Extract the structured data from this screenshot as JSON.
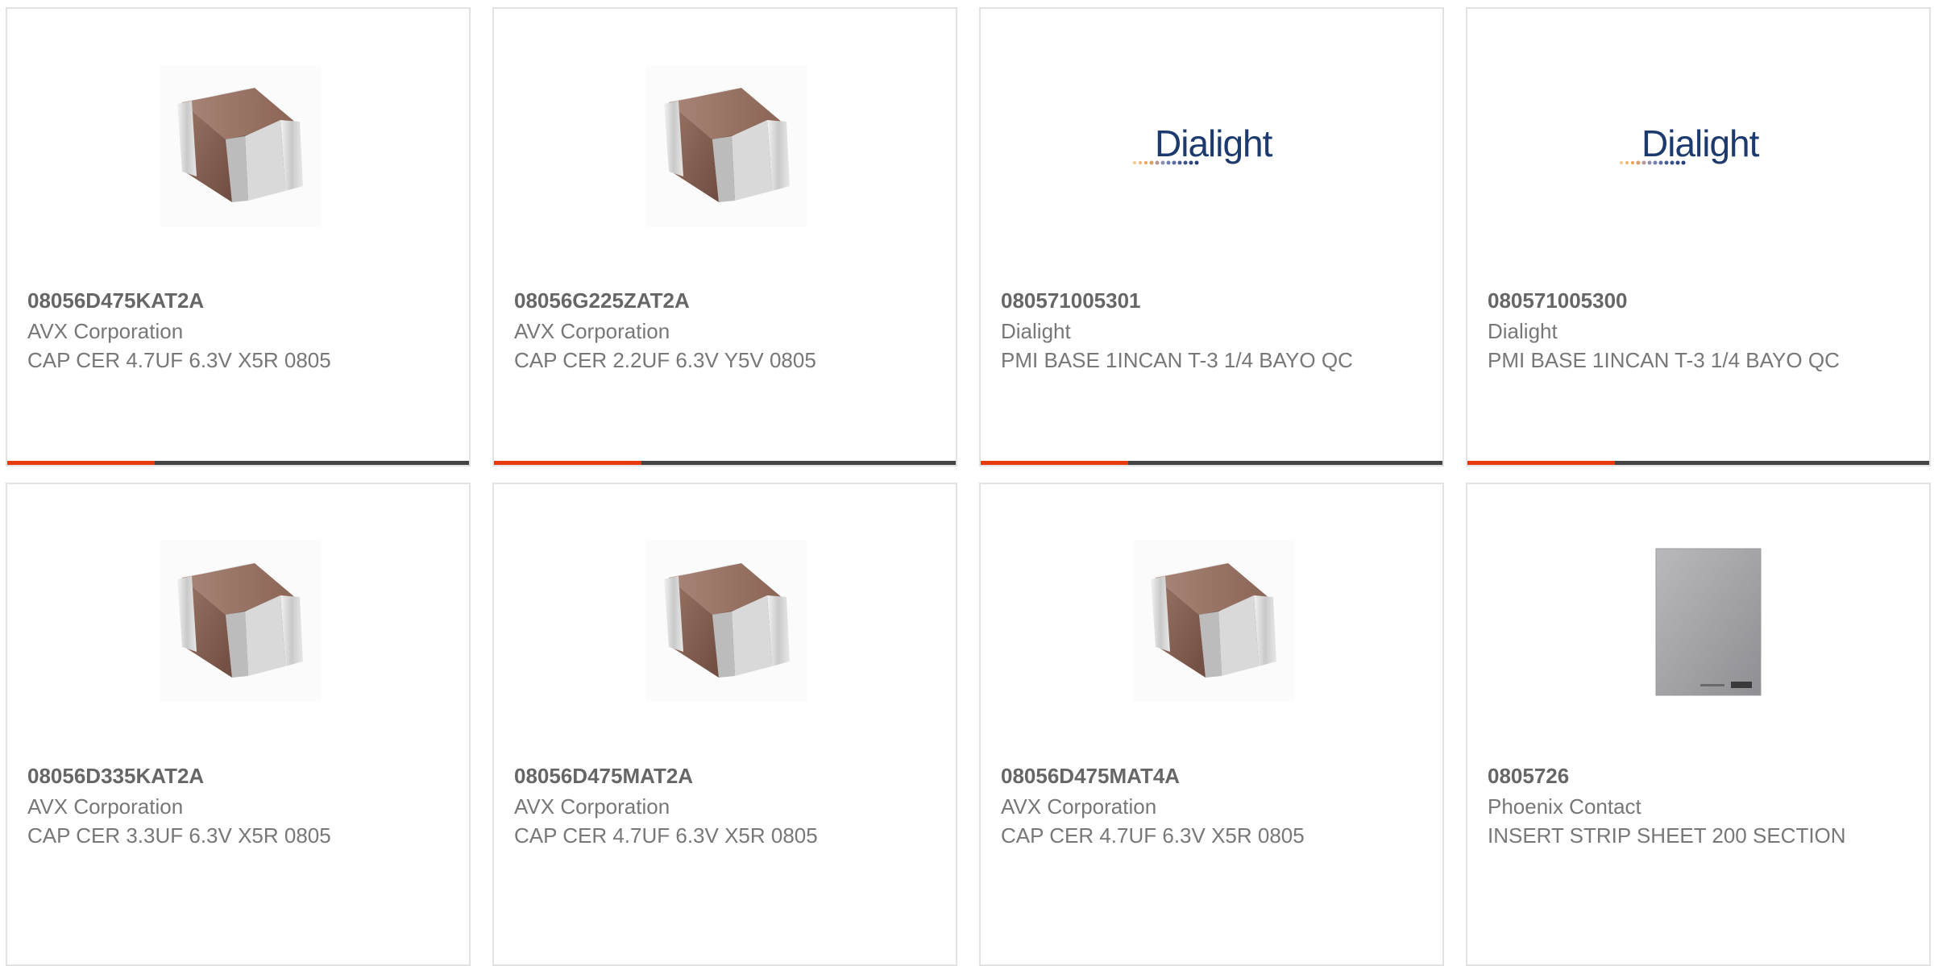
{
  "products": [
    {
      "part": "08056D475KAT2A",
      "manufacturer": "AVX Corporation",
      "description": "CAP CER 4.7UF 6.3V X5R 0805",
      "image": "ceramic-capacitor",
      "accent_color": "#e8380d"
    },
    {
      "part": "08056G225ZAT2A",
      "manufacturer": "AVX Corporation",
      "description": "CAP CER 2.2UF 6.3V Y5V 0805",
      "image": "ceramic-capacitor",
      "accent_color": "#e8380d"
    },
    {
      "part": "080571005301",
      "manufacturer": "Dialight",
      "description": "PMI BASE 1INCAN T-3 1/4 BAYO QC",
      "image": "dialight-logo",
      "logo_text": "Dialight",
      "accent_color": "#e8380d"
    },
    {
      "part": "080571005300",
      "manufacturer": "Dialight",
      "description": "PMI BASE 1INCAN T-3 1/4 BAYO QC",
      "image": "dialight-logo",
      "logo_text": "Dialight",
      "accent_color": "#e8380d"
    },
    {
      "part": "08056D335KAT2A",
      "manufacturer": "AVX Corporation",
      "description": "CAP CER 3.3UF 6.3V X5R 0805",
      "image": "ceramic-capacitor"
    },
    {
      "part": "08056D475MAT2A",
      "manufacturer": "AVX Corporation",
      "description": "CAP CER 4.7UF 6.3V X5R 0805",
      "image": "ceramic-capacitor"
    },
    {
      "part": "08056D475MAT4A",
      "manufacturer": "AVX Corporation",
      "description": "CAP CER 4.7UF 6.3V X5R 0805",
      "image": "ceramic-capacitor"
    },
    {
      "part": "0805726",
      "manufacturer": "Phoenix Contact",
      "description": "INSERT STRIP SHEET 200 SECTION",
      "image": "insert-strip-sheet"
    }
  ],
  "colors": {
    "bar_dark": "#444444",
    "bar_accent": "#e8380d",
    "dialight_blue": "#1d3a6e"
  }
}
